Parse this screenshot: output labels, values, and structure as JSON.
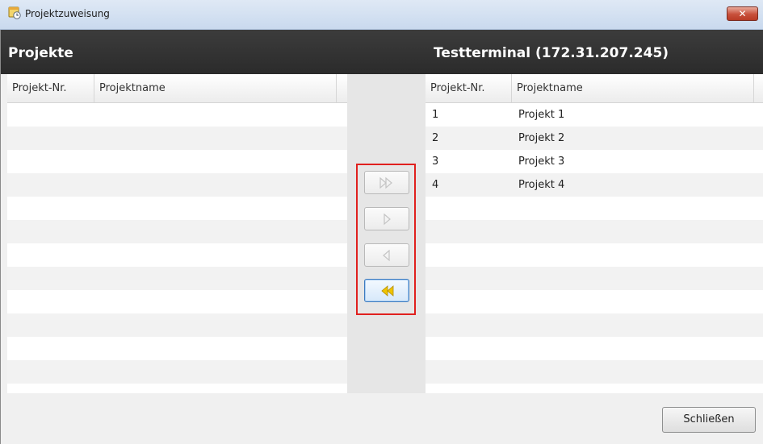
{
  "window": {
    "title": "Projektzuweisung",
    "close_symbol": "✕"
  },
  "left_pane": {
    "title": "Projekte",
    "columns": [
      "Projekt-Nr.",
      "Projektname"
    ],
    "rows": []
  },
  "right_pane": {
    "title": "Testterminal (172.31.207.245)",
    "columns": [
      "Projekt-Nr.",
      "Projektname"
    ],
    "rows": [
      {
        "nr": "1",
        "name": "Projekt 1"
      },
      {
        "nr": "2",
        "name": "Projekt 2"
      },
      {
        "nr": "3",
        "name": "Projekt 3"
      },
      {
        "nr": "4",
        "name": "Projekt 4"
      }
    ]
  },
  "transfer_buttons": [
    {
      "icon": "double-chevron-right-icon",
      "enabled": false
    },
    {
      "icon": "chevron-right-icon",
      "enabled": false
    },
    {
      "icon": "chevron-left-icon",
      "enabled": false
    },
    {
      "icon": "double-chevron-left-icon",
      "enabled": true,
      "color": "#f0c400"
    }
  ],
  "footer": {
    "close_label": "Schließen"
  }
}
